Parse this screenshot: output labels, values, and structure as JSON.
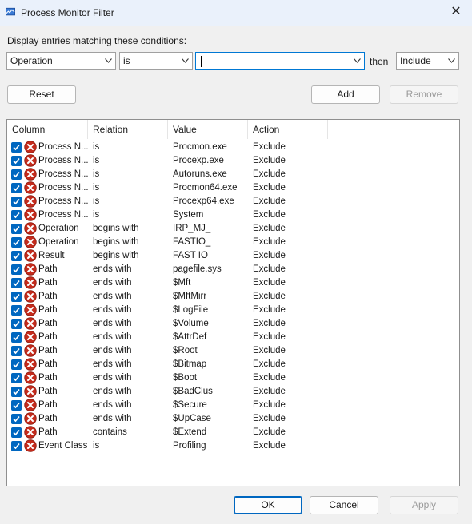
{
  "window": {
    "title": "Process Monitor Filter",
    "close_glyph": "✕"
  },
  "conditions": {
    "label": "Display entries matching these conditions:",
    "column_value": "Operation",
    "relation_value": "is",
    "value_text": "",
    "then_label": "then",
    "action_value": "Include"
  },
  "buttons": {
    "reset": "Reset",
    "add": "Add",
    "remove": "Remove",
    "ok": "OK",
    "cancel": "Cancel",
    "apply": "Apply"
  },
  "list": {
    "headers": [
      "Column",
      "Relation",
      "Value",
      "Action"
    ],
    "rows": [
      {
        "column": "Process N...",
        "relation": "is",
        "value": "Procmon.exe",
        "action": "Exclude"
      },
      {
        "column": "Process N...",
        "relation": "is",
        "value": "Procexp.exe",
        "action": "Exclude"
      },
      {
        "column": "Process N...",
        "relation": "is",
        "value": "Autoruns.exe",
        "action": "Exclude"
      },
      {
        "column": "Process N...",
        "relation": "is",
        "value": "Procmon64.exe",
        "action": "Exclude"
      },
      {
        "column": "Process N...",
        "relation": "is",
        "value": "Procexp64.exe",
        "action": "Exclude"
      },
      {
        "column": "Process N...",
        "relation": "is",
        "value": "System",
        "action": "Exclude"
      },
      {
        "column": "Operation",
        "relation": "begins with",
        "value": "IRP_MJ_",
        "action": "Exclude"
      },
      {
        "column": "Operation",
        "relation": "begins with",
        "value": "FASTIO_",
        "action": "Exclude"
      },
      {
        "column": "Result",
        "relation": "begins with",
        "value": "FAST IO",
        "action": "Exclude"
      },
      {
        "column": "Path",
        "relation": "ends with",
        "value": "pagefile.sys",
        "action": "Exclude"
      },
      {
        "column": "Path",
        "relation": "ends with",
        "value": "$Mft",
        "action": "Exclude"
      },
      {
        "column": "Path",
        "relation": "ends with",
        "value": "$MftMirr",
        "action": "Exclude"
      },
      {
        "column": "Path",
        "relation": "ends with",
        "value": "$LogFile",
        "action": "Exclude"
      },
      {
        "column": "Path",
        "relation": "ends with",
        "value": "$Volume",
        "action": "Exclude"
      },
      {
        "column": "Path",
        "relation": "ends with",
        "value": "$AttrDef",
        "action": "Exclude"
      },
      {
        "column": "Path",
        "relation": "ends with",
        "value": "$Root",
        "action": "Exclude"
      },
      {
        "column": "Path",
        "relation": "ends with",
        "value": "$Bitmap",
        "action": "Exclude"
      },
      {
        "column": "Path",
        "relation": "ends with",
        "value": "$Boot",
        "action": "Exclude"
      },
      {
        "column": "Path",
        "relation": "ends with",
        "value": "$BadClus",
        "action": "Exclude"
      },
      {
        "column": "Path",
        "relation": "ends with",
        "value": "$Secure",
        "action": "Exclude"
      },
      {
        "column": "Path",
        "relation": "ends with",
        "value": "$UpCase",
        "action": "Exclude"
      },
      {
        "column": "Path",
        "relation": "contains",
        "value": "$Extend",
        "action": "Exclude"
      },
      {
        "column": "Event Class",
        "relation": "is",
        "value": "Profiling",
        "action": "Exclude"
      }
    ],
    "row_checked": true,
    "row_icon": "exclude-x-icon"
  },
  "colors": {
    "accent": "#0067c0",
    "exclude_red": "#c42b1c"
  }
}
